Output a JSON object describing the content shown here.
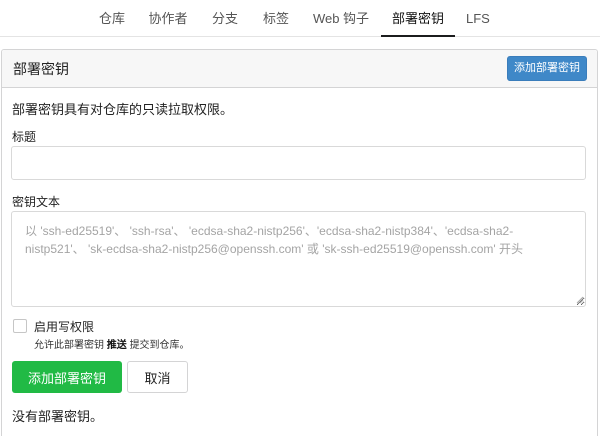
{
  "tabs": [
    {
      "label": "仓库",
      "active": false
    },
    {
      "label": "协作者",
      "active": false
    },
    {
      "label": "分支",
      "active": false
    },
    {
      "label": "标签",
      "active": false
    },
    {
      "label": "Web 钩子",
      "active": false
    },
    {
      "label": "部署密钥",
      "active": true
    },
    {
      "label": "LFS",
      "active": false
    }
  ],
  "header": {
    "title": "部署密钥",
    "add_button": "添加部署密钥"
  },
  "form": {
    "intro": "部署密钥具有对仓库的只读拉取权限。",
    "title_label": "标题",
    "title_value": "",
    "content_label": "密钥文本",
    "content_placeholder": "以 'ssh-ed25519'、 'ssh-rsa'、 'ecdsa-sha2-nistp256'、'ecdsa-sha2-nistp384'、'ecdsa-sha2-nistp521'、 'sk-ecdsa-sha2-nistp256@openssh.com' 或 'sk-ssh-ed25519@openssh.com' 开头",
    "write_access_label": "启用写权限",
    "write_access_checked": false,
    "help_prefix": "允许此部署密钥",
    "help_bold": "推送",
    "help_suffix": "提交到仓库。",
    "submit_label": "添加部署密钥",
    "cancel_label": "取消"
  },
  "empty_text": "没有部署密钥。",
  "colors": {
    "primary_blue": "#3f88c8",
    "submit_green": "#21ba45",
    "active_tab_underline": "#1b1c1d"
  }
}
